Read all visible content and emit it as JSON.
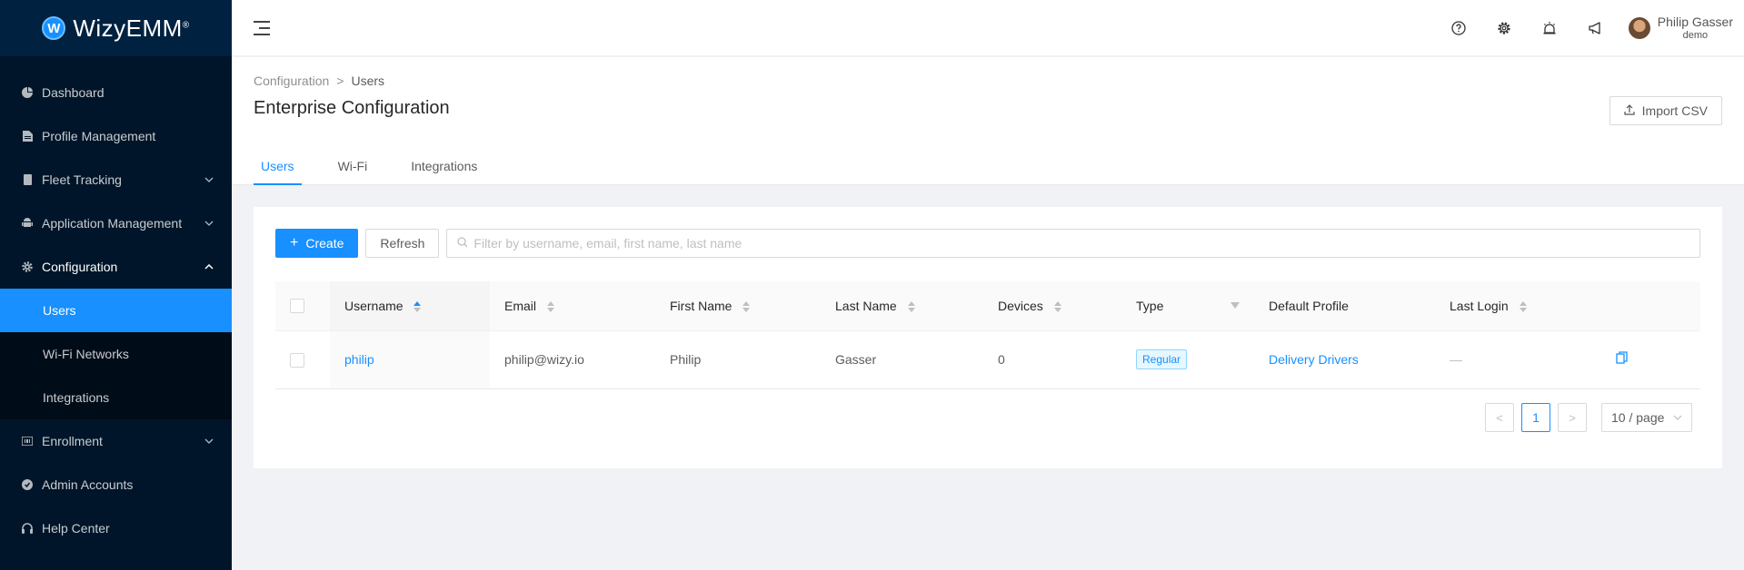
{
  "brand": {
    "logo_letter": "W",
    "name": "WizyEMM",
    "reg": "®"
  },
  "sidebar": {
    "items": [
      {
        "label": "Dashboard",
        "icon": "dashboard-icon"
      },
      {
        "label": "Profile Management",
        "icon": "file-icon"
      },
      {
        "label": "Fleet Tracking",
        "icon": "mobile-icon"
      },
      {
        "label": "Application Management",
        "icon": "android-icon"
      },
      {
        "label": "Configuration",
        "icon": "gear-icon"
      },
      {
        "label": "Enrollment",
        "icon": "barcode-icon"
      },
      {
        "label": "Admin Accounts",
        "icon": "shield-icon"
      },
      {
        "label": "Help Center",
        "icon": "headset-icon"
      }
    ],
    "config_sub": [
      {
        "label": "Users"
      },
      {
        "label": "Wi-Fi Networks"
      },
      {
        "label": "Integrations"
      }
    ]
  },
  "header": {
    "user_name": "Philip Gasser",
    "user_org": "demo"
  },
  "page": {
    "breadcrumb": [
      "Configuration",
      "Users"
    ],
    "breadcrumb_sep": ">",
    "title": "Enterprise Configuration",
    "import_label": "Import CSV",
    "tabs": [
      {
        "label": "Users"
      },
      {
        "label": "Wi-Fi"
      },
      {
        "label": "Integrations"
      }
    ]
  },
  "toolbar": {
    "create_label": "Create",
    "refresh_label": "Refresh",
    "search_placeholder": "Filter by username, email, first name, last name"
  },
  "table": {
    "columns": [
      "Username",
      "Email",
      "First Name",
      "Last Name",
      "Devices",
      "Type",
      "Default Profile",
      "Last Login"
    ],
    "rows": [
      {
        "username": "philip",
        "email": "philip@wizy.io",
        "first_name": "Philip",
        "last_name": "Gasser",
        "devices": "0",
        "type": "Regular",
        "default_profile": "Delivery Drivers",
        "last_login": "—"
      }
    ]
  },
  "pagination": {
    "current_page": "1",
    "page_size": "10 / page",
    "prev": "<",
    "next": ">"
  },
  "colors": {
    "primary": "#1890ff",
    "sidebar_bg": "#001529",
    "sidebar_active": "#1890ff"
  }
}
